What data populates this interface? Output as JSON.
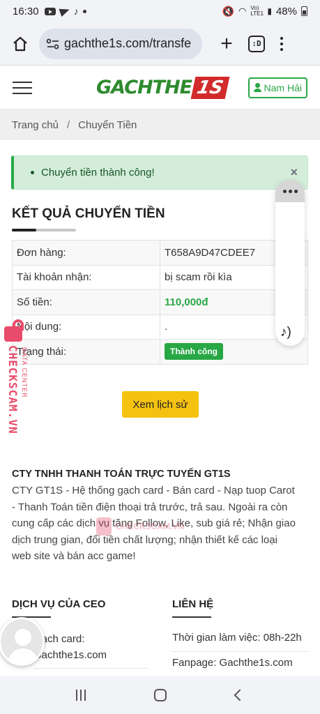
{
  "status_bar": {
    "time": "16:30",
    "network_label": "Vo) LTE1",
    "battery": "48%"
  },
  "browser": {
    "url": "gachthe1s.com/transfe",
    "tab_count": ":D"
  },
  "header": {
    "logo_text": "GACHTHE",
    "logo_badge": "1S",
    "user_name": "Nam Hải"
  },
  "breadcrumb": {
    "home": "Trang chủ",
    "separator": "/",
    "current": "Chuyển Tiền"
  },
  "alert": {
    "message": "Chuyển tiền thành công!",
    "close": "×"
  },
  "result": {
    "title": "KẾT QUẢ CHUYỂN TIỀN",
    "rows": [
      {
        "label": "Đơn hàng:",
        "value": "T658A9D47CDEE7"
      },
      {
        "label": "Tài khoản nhận:",
        "value": "bị scam rồi kìa"
      },
      {
        "label": "Số tiền:",
        "value": "110,000đ"
      },
      {
        "label": "Nội dung:",
        "value": "."
      },
      {
        "label": "Trạng thái:",
        "value": "Thành công"
      }
    ],
    "history_button": "Xem lịch sử"
  },
  "company": {
    "title": "CTY TNHH THANH TOÁN TRỰC TUYẾN GT1S",
    "description": "CTY GT1S - Hệ thống gạch card - Bán card - Nạp tuop Carot - Thanh Toán tiền điện thoại trả trước, trả sau. Ngoài ra còn cung cấp các dịch vụ tăng Follow, Like, sub giá rẻ; Nhận giao dịch trung gian, đổi tiền chất lượng; nhận thiết kế các loại web site và bán acc game!"
  },
  "footer": {
    "services_title": "DỊCH VỤ CỦA CEO",
    "services_item_line1": "Gạch card:",
    "services_item_line2": "Gachthe1s.com",
    "contact_title": "LIÊN HỆ",
    "contact_hours": "Thời gian làm việc: 08h-22h",
    "contact_fanpage": "Fanpage: Gachthe1s.com"
  },
  "watermark": {
    "main": "CHECKSCAM.VN",
    "sub": "DATA CENTER",
    "center_text": "CHECKSCAM.VN"
  },
  "colors": {
    "brand_green": "#2e8b2e",
    "brand_red": "#d22b2b",
    "success": "#28a745",
    "button_yellow": "#f5c211",
    "watermark": "#e84c6a"
  }
}
